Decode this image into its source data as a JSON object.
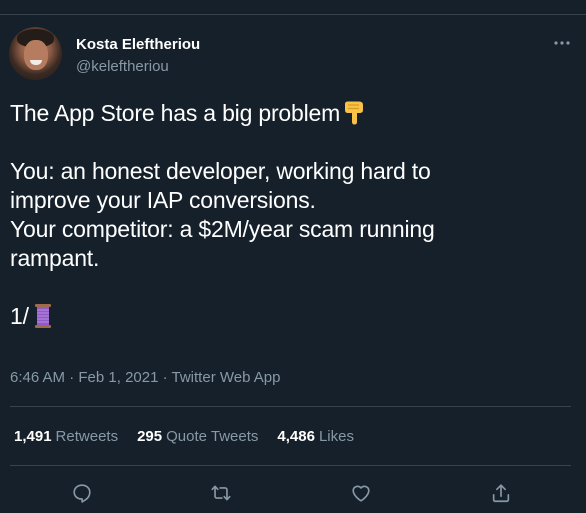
{
  "author": {
    "display_name": "Kosta Eleftheriou",
    "handle": "@keleftheriou"
  },
  "tweet": {
    "line1": "The App Store has a big problem",
    "line1_emoji": "backhand-index-pointing-down",
    "line2": "You: an honest developer, working hard to",
    "line3": "improve your IAP conversions.",
    "line4": "Your competitor: a $2M/year scam running",
    "line5": "rampant.",
    "line6": "1/",
    "line6_emoji": "thread-spool"
  },
  "meta": {
    "time": "6:46 AM",
    "separator1": " · ",
    "date": "Feb 1, 2021",
    "separator2": " · ",
    "source": "Twitter Web App"
  },
  "stats": {
    "retweets_count": "1,491",
    "retweets_label": "Retweets",
    "quote_count": "295",
    "quote_label": "Quote Tweets",
    "likes_count": "4,486",
    "likes_label": "Likes"
  },
  "actions": [
    "reply-icon",
    "retweet-icon",
    "like-icon",
    "share-icon"
  ],
  "colors": {
    "background": "#15202b",
    "text_primary": "#ffffff",
    "text_secondary": "#8899a6",
    "divider": "#38444d"
  }
}
